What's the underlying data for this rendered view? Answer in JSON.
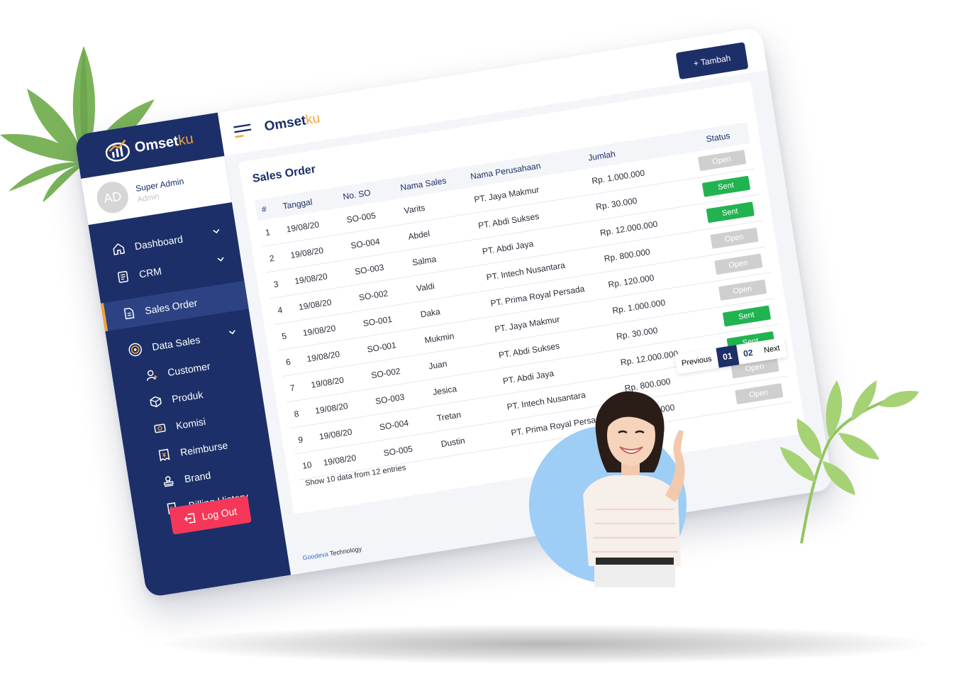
{
  "brand": {
    "name_main": "Omset",
    "name_suffix": "ku"
  },
  "profile": {
    "initials": "AD",
    "name": "Super Admin",
    "role": "Admin"
  },
  "sidebar": {
    "items": [
      {
        "label": "Dashboard",
        "icon": "home-icon",
        "expandable": true
      },
      {
        "label": "CRM",
        "icon": "document-icon",
        "expandable": true
      },
      {
        "label": "Sales Order",
        "icon": "file-icon",
        "active": true
      },
      {
        "label": "Data Sales",
        "icon": "target-icon",
        "expandable": true
      },
      {
        "label": "Customer",
        "icon": "user-add-icon"
      },
      {
        "label": "Produk",
        "icon": "box-icon"
      },
      {
        "label": "Komisi",
        "icon": "money-icon"
      },
      {
        "label": "Reimburse",
        "icon": "receipt-icon"
      },
      {
        "label": "Brand",
        "icon": "stamp-icon"
      },
      {
        "label": "Billing History",
        "icon": "bill-icon"
      }
    ],
    "logout_label": "Log Out"
  },
  "header": {
    "add_button": "+ Tambah"
  },
  "sales_order": {
    "title": "Sales Order",
    "columns": [
      "#",
      "Tanggal",
      "No. SO",
      "Nama Sales",
      "Nama Perusahaan",
      "Jumlah",
      "Status"
    ],
    "rows": [
      {
        "no": "1",
        "tanggal": "19/08/20",
        "so": "SO-005",
        "sales": "Varits",
        "company": "PT. Jaya Makmur",
        "amount": "Rp. 1.000.000",
        "status": "Open"
      },
      {
        "no": "2",
        "tanggal": "19/08/20",
        "so": "SO-004",
        "sales": "Abdel",
        "company": "PT. Abdi Sukses",
        "amount": "Rp. 30.000",
        "status": "Sent"
      },
      {
        "no": "3",
        "tanggal": "19/08/20",
        "so": "SO-003",
        "sales": "Salma",
        "company": "PT. Abdi Jaya",
        "amount": "Rp. 12.000.000",
        "status": "Sent"
      },
      {
        "no": "4",
        "tanggal": "19/08/20",
        "so": "SO-002",
        "sales": "Valdi",
        "company": "PT. Intech Nusantara",
        "amount": "Rp. 800.000",
        "status": "Open"
      },
      {
        "no": "5",
        "tanggal": "19/08/20",
        "so": "SO-001",
        "sales": "Daka",
        "company": "PT. Prima Royal Persada",
        "amount": "Rp. 120.000",
        "status": "Open"
      },
      {
        "no": "6",
        "tanggal": "19/08/20",
        "so": "SO-001",
        "sales": "Mukmin",
        "company": "PT. Jaya Makmur",
        "amount": "Rp. 1.000.000",
        "status": "Open"
      },
      {
        "no": "7",
        "tanggal": "19/08/20",
        "so": "SO-002",
        "sales": "Juan",
        "company": "PT. Abdi Sukses",
        "amount": "Rp. 30.000",
        "status": "Sent"
      },
      {
        "no": "8",
        "tanggal": "19/08/20",
        "so": "SO-003",
        "sales": "Jesica",
        "company": "PT. Abdi Jaya",
        "amount": "Rp. 12.000.000",
        "status": "Sent"
      },
      {
        "no": "9",
        "tanggal": "19/08/20",
        "so": "SO-004",
        "sales": "Tretan",
        "company": "PT. Intech Nusantara",
        "amount": "Rp. 800.000",
        "status": "Open"
      },
      {
        "no": "10",
        "tanggal": "19/08/20",
        "so": "SO-005",
        "sales": "Dustin",
        "company": "PT. Prima Royal Persada",
        "amount": "Rp. 120.000",
        "status": "Open"
      }
    ],
    "entries_text": "Show 10 data from 12 entries",
    "pagination": {
      "previous": "Previous",
      "pages": [
        "01",
        "02"
      ],
      "next": "Next"
    }
  },
  "footer": {
    "brand": "Goodeva",
    "suffix": "Technology"
  },
  "colors": {
    "navy": "#1c2f68",
    "accent": "#f2a33a",
    "sent": "#22b351",
    "open": "#cfcfcf",
    "logout": "#f5385a"
  }
}
